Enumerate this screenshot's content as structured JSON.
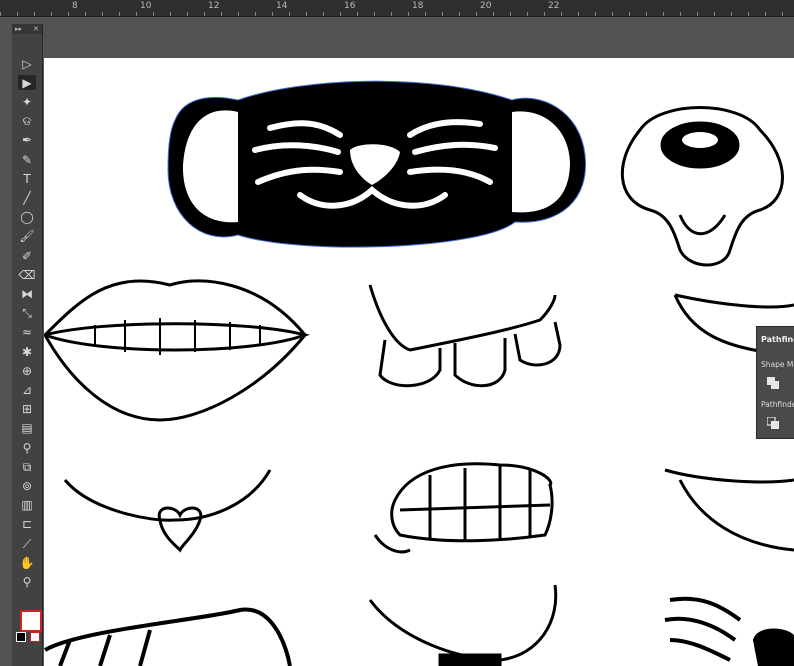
{
  "ruler": {
    "labels": [
      "8",
      "10",
      "12",
      "14",
      "16",
      "18",
      "20",
      "22"
    ]
  },
  "toolbar": {
    "tools": [
      {
        "name": "selection-tool",
        "glyph": "▷"
      },
      {
        "name": "direct-selection-tool",
        "glyph": "▶",
        "active": true
      },
      {
        "name": "magic-wand-tool",
        "glyph": "✦"
      },
      {
        "name": "lasso-tool",
        "glyph": "ଡ"
      },
      {
        "name": "pen-tool",
        "glyph": "✒"
      },
      {
        "name": "curvature-tool",
        "glyph": "✎"
      },
      {
        "name": "type-tool",
        "glyph": "T"
      },
      {
        "name": "line-segment-tool",
        "glyph": "╱"
      },
      {
        "name": "ellipse-tool",
        "glyph": "◯"
      },
      {
        "name": "paintbrush-tool",
        "glyph": "🖌"
      },
      {
        "name": "blob-brush-tool",
        "glyph": "✐"
      },
      {
        "name": "eraser-tool",
        "glyph": "⌫"
      },
      {
        "name": "reflect-tool",
        "glyph": "⧓"
      },
      {
        "name": "scale-tool",
        "glyph": "⤡"
      },
      {
        "name": "warp-tool",
        "glyph": "≈"
      },
      {
        "name": "puppet-warp-tool",
        "glyph": "✱"
      },
      {
        "name": "shape-builder-tool",
        "glyph": "⊕"
      },
      {
        "name": "perspective-grid-tool",
        "glyph": "⊿"
      },
      {
        "name": "mesh-tool",
        "glyph": "⊞"
      },
      {
        "name": "gradient-tool",
        "glyph": "▤"
      },
      {
        "name": "eyedropper-tool",
        "glyph": "⚲"
      },
      {
        "name": "blend-tool",
        "glyph": "⧉"
      },
      {
        "name": "symbol-sprayer-tool",
        "glyph": "⊚"
      },
      {
        "name": "column-graph-tool",
        "glyph": "▥"
      },
      {
        "name": "artboard-tool",
        "glyph": "⊏"
      },
      {
        "name": "slice-tool",
        "glyph": "⟋"
      },
      {
        "name": "hand-tool",
        "glyph": "✋"
      },
      {
        "name": "zoom-tool",
        "glyph": "⚲"
      }
    ]
  },
  "pathfinder_panel": {
    "title": "Pathfinde",
    "shape_modes_label": "Shape Mo",
    "pathfinders_label": "Pathfinde"
  },
  "colors": {
    "path_outline": "#4a72e0",
    "artwork_fill": "#000000",
    "canvas": "#ffffff",
    "app_background": "#535353"
  }
}
